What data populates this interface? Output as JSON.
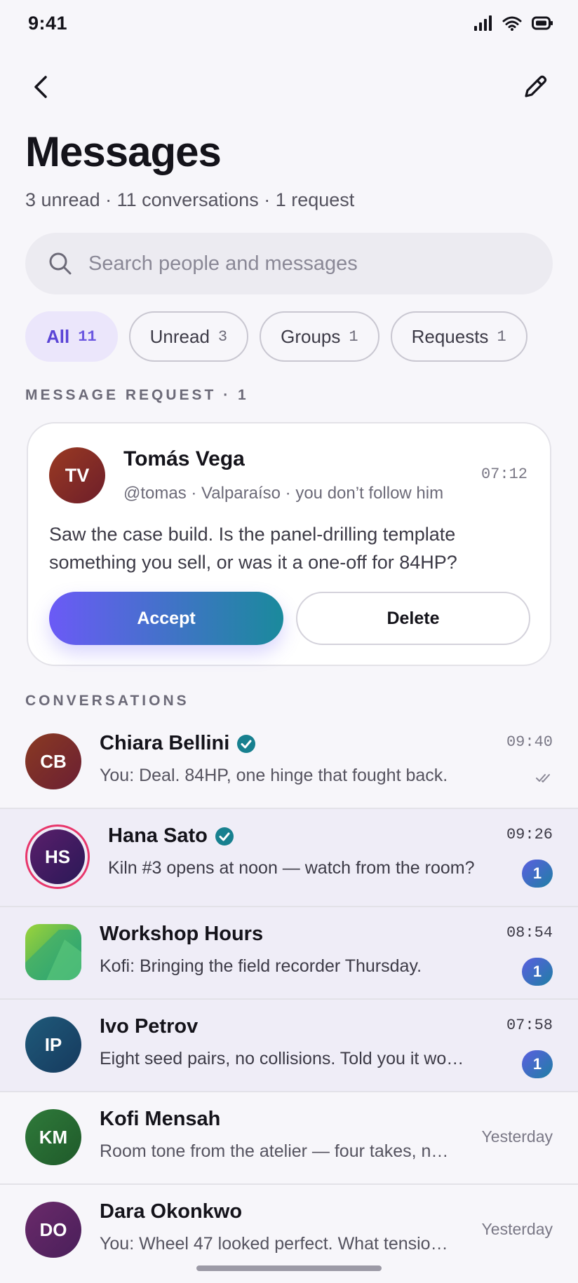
{
  "status_bar": {
    "time": "9:41",
    "icons": [
      "signal-icon",
      "wifi-icon",
      "battery-icon"
    ]
  },
  "header": {
    "back_icon": "chevron-left-icon",
    "compose_icon": "pencil-icon",
    "title": "Messages",
    "subtitle": "3 unread · 11 conversations · 1 request"
  },
  "search": {
    "placeholder": "Search people and messages",
    "value": "",
    "icon": "search-icon"
  },
  "filters": [
    {
      "label": "All",
      "count": "11",
      "active": true
    },
    {
      "label": "Unread",
      "count": "3",
      "active": false
    },
    {
      "label": "Groups",
      "count": "1",
      "active": false
    },
    {
      "label": "Requests",
      "count": "1",
      "active": false
    }
  ],
  "request_section": {
    "label": "MESSAGE REQUEST · 1"
  },
  "request": {
    "initials": "TV",
    "name": "Tomás Vega",
    "meta": "@tomas · Valparaíso · you don’t follow him",
    "time": "07:12",
    "body": "Saw the case build. Is the panel-drilling template something you sell, or was it a one-off for 84HP?",
    "accept_label": "Accept",
    "delete_label": "Delete"
  },
  "conversations_section": {
    "label": "CONVERSATIONS"
  },
  "conversations": [
    {
      "initials": "CB",
      "name": "Chiara Bellini",
      "verified": true,
      "preview": "You: Deal. 84HP, one hinge that fought back.",
      "time": "09:40",
      "status": "read"
    },
    {
      "initials": "HS",
      "name": "Hana Sato",
      "verified": true,
      "preview": "Kiln #3 opens at noon — watch from the room?",
      "time": "09:26",
      "unread": "1",
      "story_ring": true
    },
    {
      "initials": "",
      "name": "Workshop Hours",
      "verified": false,
      "preview": "Kofi: Bringing the field recorder Thursday.",
      "time": "08:54",
      "unread": "1",
      "group": true
    },
    {
      "initials": "IP",
      "name": "Ivo Petrov",
      "verified": false,
      "preview": "Eight seed pairs, no collisions. Told you it woul…",
      "time": "07:58",
      "unread": "1"
    },
    {
      "initials": "KM",
      "name": "Kofi Mensah",
      "verified": false,
      "preview": "Room tone from the atelier — four takes, n…",
      "time": "Yesterday"
    },
    {
      "initials": "DO",
      "name": "Dara Okonkwo",
      "verified": false,
      "preview": "You: Wheel 47 looked perfect. What tensio…",
      "time": "Yesterday"
    }
  ],
  "colors": {
    "accent": "#6b5af6",
    "accent_teal": "#1a8a9c",
    "verified": "#17808f",
    "story_ring": "#e8366b",
    "background": "#f7f6fa"
  }
}
